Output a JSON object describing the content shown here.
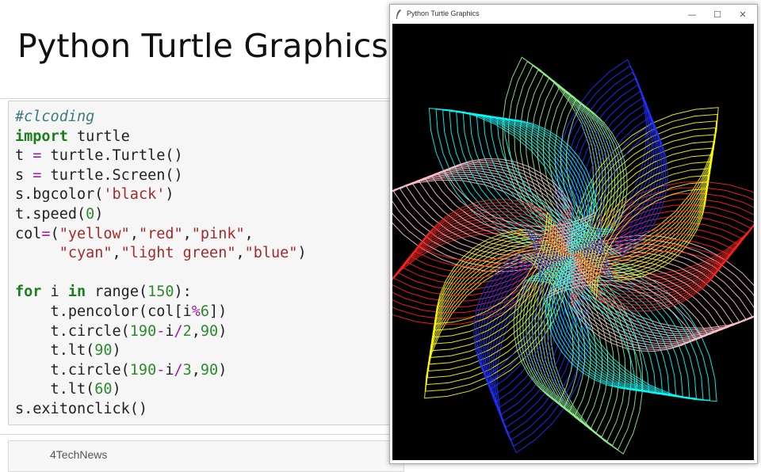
{
  "slide": {
    "title": "Python Turtle Graphics",
    "footer": "4TechNews"
  },
  "code": {
    "lines": [
      [
        {
          "t": "#clcoding",
          "k": "comment"
        }
      ],
      [
        {
          "t": "import",
          "k": "kw"
        },
        {
          "t": " turtle",
          "k": "plain"
        }
      ],
      [
        {
          "t": "t ",
          "k": "plain"
        },
        {
          "t": "=",
          "k": "op"
        },
        {
          "t": " turtle.Turtle()",
          "k": "plain"
        }
      ],
      [
        {
          "t": "s ",
          "k": "plain"
        },
        {
          "t": "=",
          "k": "op"
        },
        {
          "t": " turtle.Screen()",
          "k": "plain"
        }
      ],
      [
        {
          "t": "s.bgcolor(",
          "k": "plain"
        },
        {
          "t": "'black'",
          "k": "str"
        },
        {
          "t": ")",
          "k": "plain"
        }
      ],
      [
        {
          "t": "t.speed(",
          "k": "plain"
        },
        {
          "t": "0",
          "k": "num"
        },
        {
          "t": ")",
          "k": "plain"
        }
      ],
      [
        {
          "t": "col",
          "k": "plain"
        },
        {
          "t": "=",
          "k": "op"
        },
        {
          "t": "(",
          "k": "plain"
        },
        {
          "t": "\"yellow\"",
          "k": "str"
        },
        {
          "t": ",",
          "k": "plain"
        },
        {
          "t": "\"red\"",
          "k": "str"
        },
        {
          "t": ",",
          "k": "plain"
        },
        {
          "t": "\"pink\"",
          "k": "str"
        },
        {
          "t": ",",
          "k": "plain"
        }
      ],
      [
        {
          "t": "     ",
          "k": "plain"
        },
        {
          "t": "\"cyan\"",
          "k": "str"
        },
        {
          "t": ",",
          "k": "plain"
        },
        {
          "t": "\"light green\"",
          "k": "str"
        },
        {
          "t": ",",
          "k": "plain"
        },
        {
          "t": "\"blue\"",
          "k": "str"
        },
        {
          "t": ")",
          "k": "plain"
        }
      ],
      [],
      [
        {
          "t": "for",
          "k": "kw"
        },
        {
          "t": " i ",
          "k": "plain"
        },
        {
          "t": "in",
          "k": "kw"
        },
        {
          "t": " range(",
          "k": "plain"
        },
        {
          "t": "150",
          "k": "num"
        },
        {
          "t": "):",
          "k": "plain"
        }
      ],
      [
        {
          "t": "    t.pencolor(col[i",
          "k": "plain"
        },
        {
          "t": "%",
          "k": "op"
        },
        {
          "t": "6",
          "k": "num"
        },
        {
          "t": "])",
          "k": "plain"
        }
      ],
      [
        {
          "t": "    t.circle(",
          "k": "plain"
        },
        {
          "t": "190",
          "k": "num"
        },
        {
          "t": "-",
          "k": "op"
        },
        {
          "t": "i",
          "k": "plain"
        },
        {
          "t": "/",
          "k": "op"
        },
        {
          "t": "2",
          "k": "num"
        },
        {
          "t": ",",
          "k": "plain"
        },
        {
          "t": "90",
          "k": "num"
        },
        {
          "t": ")",
          "k": "plain"
        }
      ],
      [
        {
          "t": "    t.lt(",
          "k": "plain"
        },
        {
          "t": "90",
          "k": "num"
        },
        {
          "t": ")",
          "k": "plain"
        }
      ],
      [
        {
          "t": "    t.circle(",
          "k": "plain"
        },
        {
          "t": "190",
          "k": "num"
        },
        {
          "t": "-",
          "k": "op"
        },
        {
          "t": "i",
          "k": "plain"
        },
        {
          "t": "/",
          "k": "op"
        },
        {
          "t": "3",
          "k": "num"
        },
        {
          "t": ",",
          "k": "plain"
        },
        {
          "t": "90",
          "k": "num"
        },
        {
          "t": ")",
          "k": "plain"
        }
      ],
      [
        {
          "t": "    t.lt(",
          "k": "plain"
        },
        {
          "t": "60",
          "k": "num"
        },
        {
          "t": ")",
          "k": "plain"
        }
      ],
      [
        {
          "t": "s.exitonclick()",
          "k": "plain"
        }
      ]
    ]
  },
  "window": {
    "title": "Python Turtle Graphics",
    "minimize_glyph": "—",
    "maximize_glyph": "☐",
    "close_glyph": "✕",
    "canvas_background": "#000000",
    "pen_colors": [
      "#ffff00",
      "#ff2020",
      "#ffc0cb",
      "#00ffff",
      "#90ee90",
      "#2030ff"
    ]
  },
  "colors": {
    "comment": "#3b7b7b",
    "keyword": "#1a7f1a",
    "operator": "#a31ba3",
    "string": "#a52a2a",
    "number": "#2f8a2f"
  }
}
